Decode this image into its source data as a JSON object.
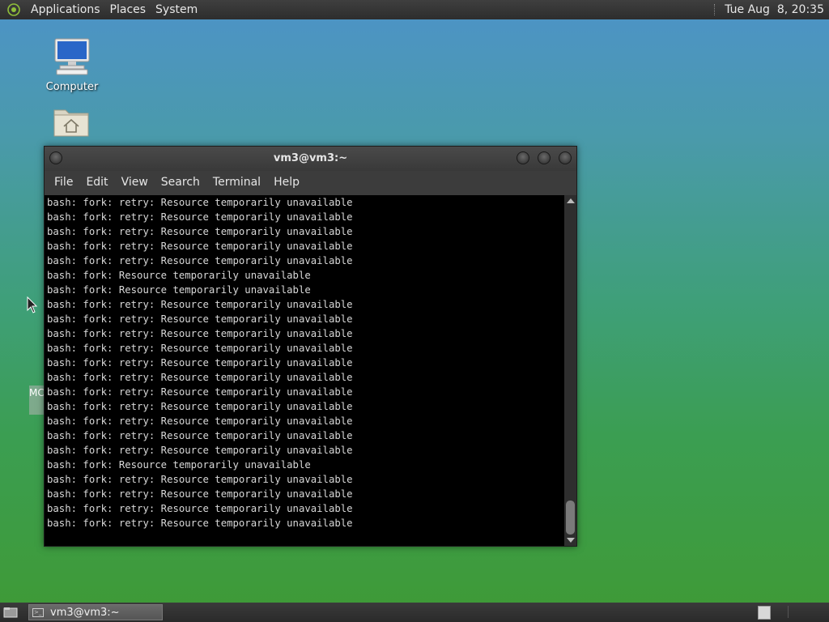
{
  "top_panel": {
    "menus": [
      "Applications",
      "Places",
      "System"
    ],
    "clock": "Tue Aug  8, 20:35"
  },
  "desktop": {
    "icons": [
      {
        "label": "Computer",
        "icon": "computer-icon"
      },
      {
        "label": "",
        "icon": "home-folder-icon"
      }
    ],
    "partial_label": "MC"
  },
  "terminal": {
    "title": "vm3@vm3:~",
    "menu": [
      "File",
      "Edit",
      "View",
      "Search",
      "Terminal",
      "Help"
    ],
    "lines": [
      "bash: fork: retry: Resource temporarily unavailable",
      "bash: fork: retry: Resource temporarily unavailable",
      "bash: fork: retry: Resource temporarily unavailable",
      "bash: fork: retry: Resource temporarily unavailable",
      "bash: fork: retry: Resource temporarily unavailable",
      "bash: fork: Resource temporarily unavailable",
      "bash: fork: Resource temporarily unavailable",
      "bash: fork: retry: Resource temporarily unavailable",
      "bash: fork: retry: Resource temporarily unavailable",
      "bash: fork: retry: Resource temporarily unavailable",
      "bash: fork: retry: Resource temporarily unavailable",
      "bash: fork: retry: Resource temporarily unavailable",
      "bash: fork: retry: Resource temporarily unavailable",
      "bash: fork: retry: Resource temporarily unavailable",
      "bash: fork: retry: Resource temporarily unavailable",
      "bash: fork: retry: Resource temporarily unavailable",
      "bash: fork: retry: Resource temporarily unavailable",
      "bash: fork: retry: Resource temporarily unavailable",
      "bash: fork: Resource temporarily unavailable",
      "bash: fork: retry: Resource temporarily unavailable",
      "bash: fork: retry: Resource temporarily unavailable",
      "bash: fork: retry: Resource temporarily unavailable",
      "bash: fork: retry: Resource temporarily unavailable"
    ]
  },
  "bottom_panel": {
    "task_label": "vm3@vm3:~"
  },
  "colors": {
    "panel": "#2d2d2d",
    "terminal_bg": "#000000",
    "terminal_fg": "#d8d8d8"
  }
}
